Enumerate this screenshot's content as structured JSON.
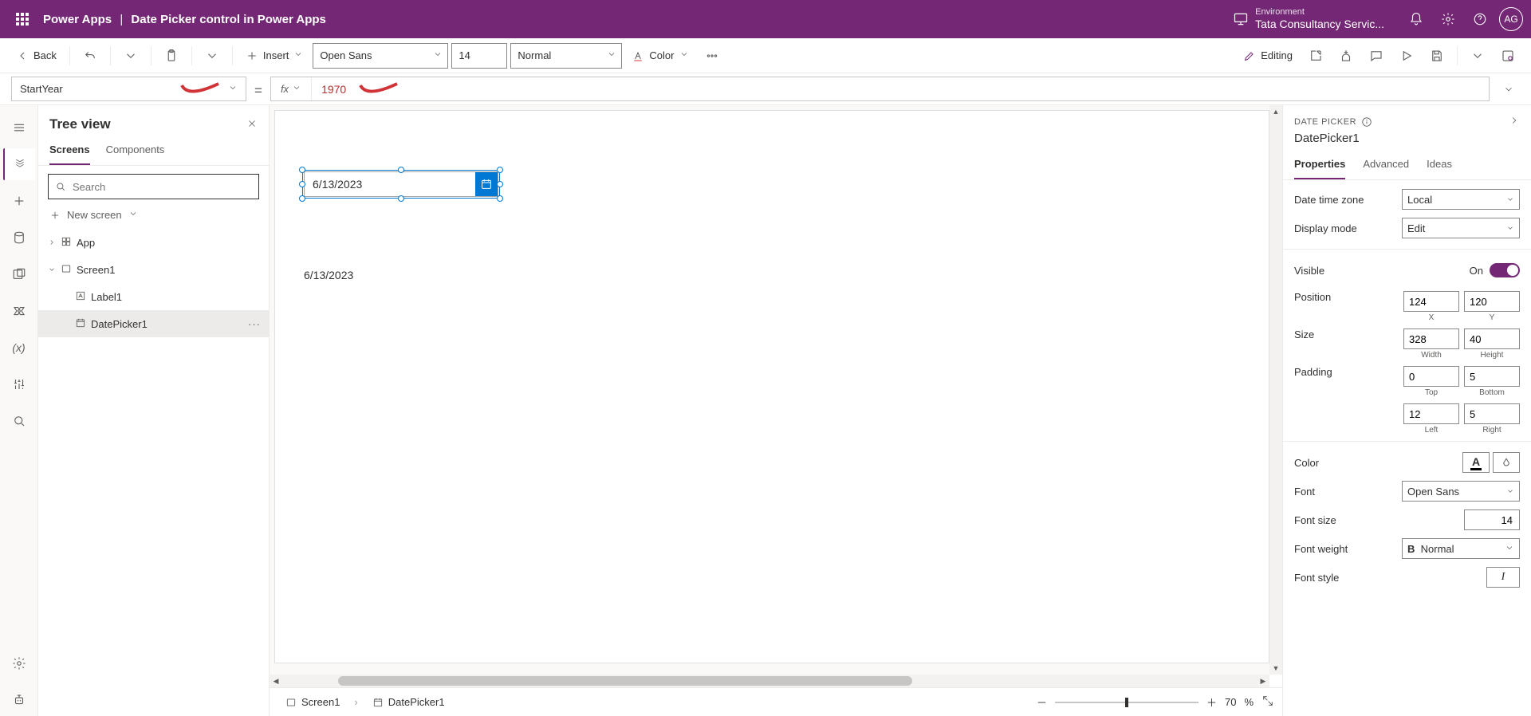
{
  "header": {
    "app": "Power Apps",
    "doc": "Date Picker control in Power Apps",
    "env_label": "Environment",
    "env_name": "Tata Consultancy Servic...",
    "avatar": "AG"
  },
  "cmd": {
    "back": "Back",
    "insert": "Insert",
    "font": "Open Sans",
    "font_size": "14",
    "font_weight": "Normal",
    "color": "Color",
    "editing": "Editing"
  },
  "formula": {
    "property": "StartYear",
    "fx": "fx",
    "value": "1970"
  },
  "treeview": {
    "title": "Tree view",
    "tabs": {
      "screens": "Screens",
      "components": "Components"
    },
    "search_placeholder": "Search",
    "new_screen": "New screen",
    "items": {
      "app": "App",
      "screen1": "Screen1",
      "label1": "Label1",
      "datepicker1": "DatePicker1"
    }
  },
  "canvas": {
    "datepicker_value": "6/13/2023",
    "label_value": "6/13/2023"
  },
  "breadcrumb": {
    "screen": "Screen1",
    "control": "DatePicker1"
  },
  "zoom": {
    "value": "70",
    "pct": "%"
  },
  "props": {
    "kind": "DATE PICKER",
    "name": "DatePicker1",
    "tabs": {
      "properties": "Properties",
      "advanced": "Advanced",
      "ideas": "Ideas"
    },
    "date_time_zone_label": "Date time zone",
    "date_time_zone_value": "Local",
    "display_mode_label": "Display mode",
    "display_mode_value": "Edit",
    "visible_label": "Visible",
    "visible_on": "On",
    "position_label": "Position",
    "position_x": "124",
    "position_y": "120",
    "position_x_sub": "X",
    "position_y_sub": "Y",
    "size_label": "Size",
    "size_w": "328",
    "size_h": "40",
    "size_w_sub": "Width",
    "size_h_sub": "Height",
    "padding_label": "Padding",
    "pad_t": "0",
    "pad_b": "5",
    "pad_t_sub": "Top",
    "pad_b_sub": "Bottom",
    "pad_l": "12",
    "pad_r": "5",
    "pad_l_sub": "Left",
    "pad_r_sub": "Right",
    "color_label": "Color",
    "font_label": "Font",
    "font_value": "Open Sans",
    "font_size_label": "Font size",
    "font_size_value": "14",
    "font_weight_label": "Font weight",
    "font_weight_value": "Normal",
    "font_style_label": "Font style",
    "font_style_value": "I"
  }
}
